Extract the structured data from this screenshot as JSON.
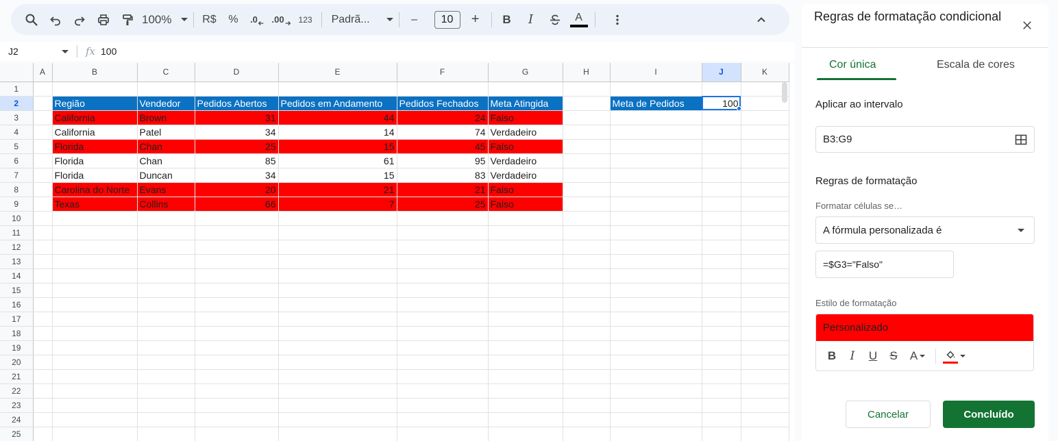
{
  "toolbar": {
    "zoom": "100%",
    "currency": "R$",
    "percent": "%",
    "decrease_decimal": ".0",
    "increase_decimal": ".00",
    "number_format": "123",
    "font": "Padrã...",
    "font_size": "10",
    "minus": "–",
    "plus": "+",
    "bold": "B",
    "italic": "I",
    "text_color": "A"
  },
  "formula_bar": {
    "cell_ref": "J2",
    "fx": "fx",
    "value": "100"
  },
  "grid": {
    "columns": [
      "",
      "A",
      "B",
      "C",
      "D",
      "E",
      "F",
      "G",
      "H",
      "I",
      "J",
      "K"
    ],
    "rows": [
      "1",
      "2",
      "3",
      "4",
      "5",
      "6",
      "7",
      "8",
      "9",
      "10",
      "11",
      "12",
      "13",
      "14",
      "15",
      "16",
      "17",
      "18",
      "19",
      "20",
      "21",
      "22",
      "23",
      "24",
      "25"
    ],
    "headers": [
      "Região",
      "Vendedor",
      "Pedidos Abertos",
      "Pedidos em Andamento",
      "Pedidos Fechados",
      "Meta Atingida"
    ],
    "data": [
      [
        "California",
        "Brown",
        "31",
        "44",
        "24",
        "Falso"
      ],
      [
        "California",
        "Patel",
        "34",
        "14",
        "74",
        "Verdadeiro"
      ],
      [
        "Florida",
        "Chan",
        "25",
        "15",
        "45",
        "Falso"
      ],
      [
        "Florida",
        "Chan",
        "85",
        "61",
        "95",
        "Verdadeiro"
      ],
      [
        "Florida",
        "Duncan",
        "34",
        "15",
        "83",
        "Verdadeiro"
      ],
      [
        "Carolina do Norte",
        "Evans",
        "20",
        "21",
        "21",
        "Falso"
      ],
      [
        "Texas",
        "Collins",
        "66",
        "7",
        "25",
        "Falso"
      ]
    ],
    "highlight_rows": [
      true,
      false,
      true,
      false,
      false,
      true,
      true
    ],
    "target_label": "Meta de Pedidos",
    "target_value": "100"
  },
  "panel": {
    "title": "Regras de formatação condicional",
    "tabs": {
      "single": "Cor única",
      "scale": "Escala de cores"
    },
    "apply_range_label": "Aplicar ao intervalo",
    "apply_range_value": "B3:G9",
    "rules_label": "Regras de formatação",
    "condition_label": "Formatar células se…",
    "condition_value": "A fórmula personalizada é",
    "formula_value": "=$G3=\"Falso\"",
    "style_label": "Estilo de formatação",
    "style_preview": "Personalizado",
    "style_tools": {
      "bold": "B",
      "italic": "I",
      "underline": "U",
      "strike": "S",
      "text_color": "A"
    },
    "cancel": "Cancelar",
    "done": "Concluído"
  },
  "colors": {
    "header_blue": "#0b71c2",
    "highlight_red": "#ff0000",
    "accent_green": "#137333",
    "selection_blue": "#1a73e8"
  }
}
